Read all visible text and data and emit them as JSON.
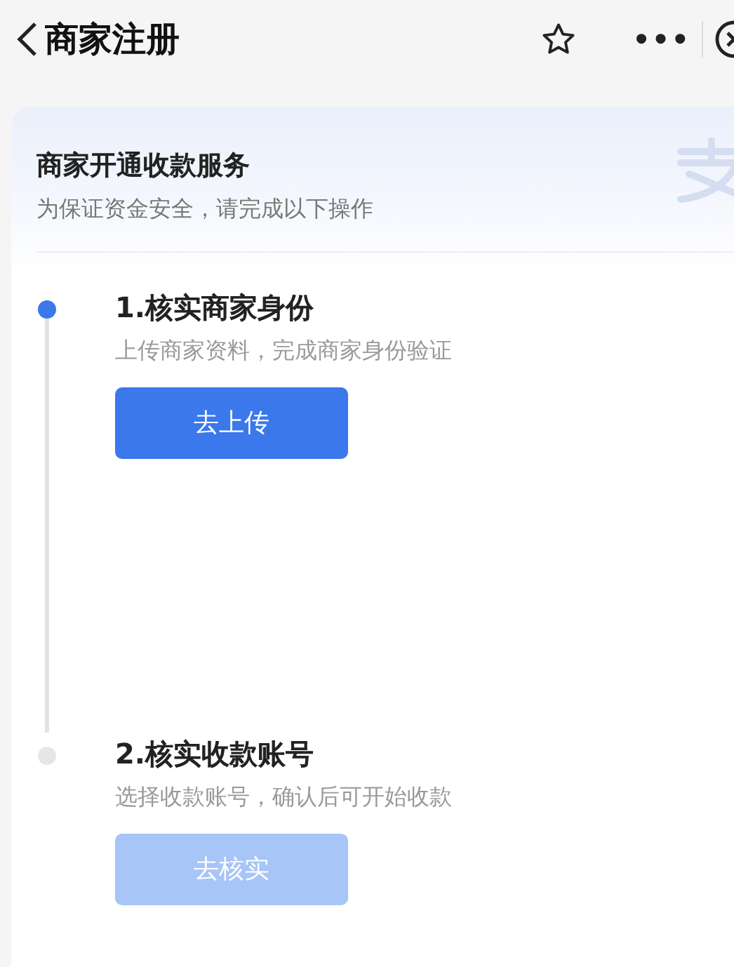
{
  "nav_bar": {
    "title": "商家注册",
    "more": "•••"
  },
  "card": {
    "title": "商家开通收款服务",
    "subtitle": "为保证资金安全，请完成以下操作"
  },
  "steps": [
    {
      "title": "1.核实商家身份",
      "description": "上传商家资料，完成商家身份验证",
      "button": "去上传",
      "active": true,
      "disabled": false
    },
    {
      "title": "2.核实收款账号",
      "description": "选择收款账号，确认后可开始收款",
      "button": "去核实",
      "active": false,
      "disabled": true
    }
  ]
}
